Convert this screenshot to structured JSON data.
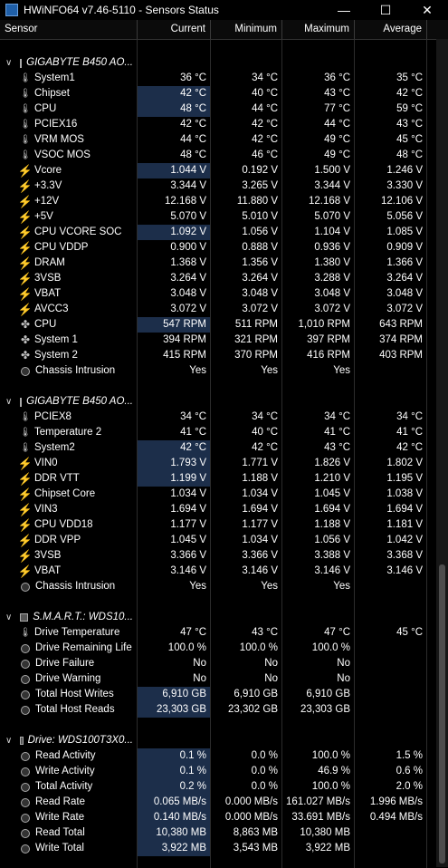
{
  "window": {
    "title": "HWiNFO64 v7.46-5110 - Sensors Status"
  },
  "columns": {
    "sensor": "Sensor",
    "current": "Current",
    "minimum": "Minimum",
    "maximum": "Maximum",
    "average": "Average"
  },
  "groups": [
    {
      "name": "GIGABYTE B450 AO...",
      "icon": "chip-icon",
      "rows": [
        {
          "n": "System1",
          "i": "thermo",
          "c": "36 °C",
          "mi": "34 °C",
          "ma": "36 °C",
          "a": "35 °C"
        },
        {
          "n": "Chipset",
          "i": "thermo",
          "c": "42 °C",
          "mi": "40 °C",
          "ma": "43 °C",
          "a": "42 °C",
          "hl": true
        },
        {
          "n": "CPU",
          "i": "thermo",
          "c": "48 °C",
          "mi": "44 °C",
          "ma": "77 °C",
          "a": "59 °C",
          "hl": true
        },
        {
          "n": "PCIEX16",
          "i": "thermo",
          "c": "42 °C",
          "mi": "42 °C",
          "ma": "44 °C",
          "a": "43 °C"
        },
        {
          "n": "VRM MOS",
          "i": "thermo",
          "c": "44 °C",
          "mi": "42 °C",
          "ma": "49 °C",
          "a": "45 °C"
        },
        {
          "n": "VSOC MOS",
          "i": "thermo",
          "c": "48 °C",
          "mi": "46 °C",
          "ma": "49 °C",
          "a": "48 °C"
        },
        {
          "n": "Vcore",
          "i": "bolt",
          "c": "1.044 V",
          "mi": "0.192 V",
          "ma": "1.500 V",
          "a": "1.246 V",
          "hl": true
        },
        {
          "n": "+3.3V",
          "i": "bolt",
          "c": "3.344 V",
          "mi": "3.265 V",
          "ma": "3.344 V",
          "a": "3.330 V"
        },
        {
          "n": "+12V",
          "i": "bolt",
          "c": "12.168 V",
          "mi": "11.880 V",
          "ma": "12.168 V",
          "a": "12.106 V"
        },
        {
          "n": "+5V",
          "i": "bolt",
          "c": "5.070 V",
          "mi": "5.010 V",
          "ma": "5.070 V",
          "a": "5.056 V"
        },
        {
          "n": "CPU VCORE SOC",
          "i": "bolt",
          "c": "1.092 V",
          "mi": "1.056 V",
          "ma": "1.104 V",
          "a": "1.085 V",
          "hl": true
        },
        {
          "n": "CPU VDDP",
          "i": "bolt",
          "c": "0.900 V",
          "mi": "0.888 V",
          "ma": "0.936 V",
          "a": "0.909 V"
        },
        {
          "n": "DRAM",
          "i": "bolt",
          "c": "1.368 V",
          "mi": "1.356 V",
          "ma": "1.380 V",
          "a": "1.366 V"
        },
        {
          "n": "3VSB",
          "i": "bolt",
          "c": "3.264 V",
          "mi": "3.264 V",
          "ma": "3.288 V",
          "a": "3.264 V"
        },
        {
          "n": "VBAT",
          "i": "bolt",
          "c": "3.048 V",
          "mi": "3.048 V",
          "ma": "3.048 V",
          "a": "3.048 V"
        },
        {
          "n": "AVCC3",
          "i": "bolt",
          "c": "3.072 V",
          "mi": "3.072 V",
          "ma": "3.072 V",
          "a": "3.072 V"
        },
        {
          "n": "CPU",
          "i": "fan",
          "c": "547 RPM",
          "mi": "511 RPM",
          "ma": "1,010 RPM",
          "a": "643 RPM",
          "hl": true
        },
        {
          "n": "System 1",
          "i": "fan",
          "c": "394 RPM",
          "mi": "321 RPM",
          "ma": "397 RPM",
          "a": "374 RPM"
        },
        {
          "n": "System 2",
          "i": "fan",
          "c": "415 RPM",
          "mi": "370 RPM",
          "ma": "416 RPM",
          "a": "403 RPM"
        },
        {
          "n": "Chassis Intrusion",
          "i": "circ",
          "c": "Yes",
          "mi": "Yes",
          "ma": "Yes",
          "a": ""
        }
      ]
    },
    {
      "name": "GIGABYTE B450 AO...",
      "icon": "chip-icon",
      "rows": [
        {
          "n": "PCIEX8",
          "i": "thermo",
          "c": "34 °C",
          "mi": "34 °C",
          "ma": "34 °C",
          "a": "34 °C"
        },
        {
          "n": "Temperature 2",
          "i": "thermo",
          "c": "41 °C",
          "mi": "40 °C",
          "ma": "41 °C",
          "a": "41 °C"
        },
        {
          "n": "System2",
          "i": "thermo",
          "c": "42 °C",
          "mi": "42 °C",
          "ma": "43 °C",
          "a": "42 °C",
          "hl": true
        },
        {
          "n": "VIN0",
          "i": "bolt",
          "c": "1.793 V",
          "mi": "1.771 V",
          "ma": "1.826 V",
          "a": "1.802 V",
          "hl": true
        },
        {
          "n": "DDR VTT",
          "i": "bolt",
          "c": "1.199 V",
          "mi": "1.188 V",
          "ma": "1.210 V",
          "a": "1.195 V",
          "hl": true
        },
        {
          "n": "Chipset Core",
          "i": "bolt",
          "c": "1.034 V",
          "mi": "1.034 V",
          "ma": "1.045 V",
          "a": "1.038 V"
        },
        {
          "n": "VIN3",
          "i": "bolt",
          "c": "1.694 V",
          "mi": "1.694 V",
          "ma": "1.694 V",
          "a": "1.694 V"
        },
        {
          "n": "CPU VDD18",
          "i": "bolt",
          "c": "1.177 V",
          "mi": "1.177 V",
          "ma": "1.188 V",
          "a": "1.181 V"
        },
        {
          "n": "DDR VPP",
          "i": "bolt",
          "c": "1.045 V",
          "mi": "1.034 V",
          "ma": "1.056 V",
          "a": "1.042 V"
        },
        {
          "n": "3VSB",
          "i": "bolt",
          "c": "3.366 V",
          "mi": "3.366 V",
          "ma": "3.388 V",
          "a": "3.368 V"
        },
        {
          "n": "VBAT",
          "i": "bolt",
          "c": "3.146 V",
          "mi": "3.146 V",
          "ma": "3.146 V",
          "a": "3.146 V"
        },
        {
          "n": "Chassis Intrusion",
          "i": "circ",
          "c": "Yes",
          "mi": "Yes",
          "ma": "Yes",
          "a": ""
        }
      ]
    },
    {
      "name": "S.M.A.R.T.: WDS10...",
      "icon": "drive-icon",
      "rows": [
        {
          "n": "Drive Temperature",
          "i": "thermo",
          "c": "47 °C",
          "mi": "43 °C",
          "ma": "47 °C",
          "a": "45 °C"
        },
        {
          "n": "Drive Remaining Life",
          "i": "circ",
          "c": "100.0 %",
          "mi": "100.0 %",
          "ma": "100.0 %",
          "a": ""
        },
        {
          "n": "Drive Failure",
          "i": "circ",
          "c": "No",
          "mi": "No",
          "ma": "No",
          "a": ""
        },
        {
          "n": "Drive Warning",
          "i": "circ",
          "c": "No",
          "mi": "No",
          "ma": "No",
          "a": ""
        },
        {
          "n": "Total Host Writes",
          "i": "circ",
          "c": "6,910 GB",
          "mi": "6,910 GB",
          "ma": "6,910 GB",
          "a": "",
          "hl": true
        },
        {
          "n": "Total Host Reads",
          "i": "circ",
          "c": "23,303 GB",
          "mi": "23,302 GB",
          "ma": "23,303 GB",
          "a": "",
          "hl": true
        }
      ]
    },
    {
      "name": "Drive: WDS100T3X0...",
      "icon": "drive-icon",
      "rows": [
        {
          "n": "Read Activity",
          "i": "circ",
          "c": "0.1 %",
          "mi": "0.0 %",
          "ma": "100.0 %",
          "a": "1.5 %",
          "hl": true
        },
        {
          "n": "Write Activity",
          "i": "circ",
          "c": "0.1 %",
          "mi": "0.0 %",
          "ma": "46.9 %",
          "a": "0.6 %",
          "hl": true
        },
        {
          "n": "Total Activity",
          "i": "circ",
          "c": "0.2 %",
          "mi": "0.0 %",
          "ma": "100.0 %",
          "a": "2.0 %",
          "hl": true
        },
        {
          "n": "Read Rate",
          "i": "circ",
          "c": "0.065 MB/s",
          "mi": "0.000 MB/s",
          "ma": "161.027 MB/s",
          "a": "1.996 MB/s",
          "hl": true
        },
        {
          "n": "Write Rate",
          "i": "circ",
          "c": "0.140 MB/s",
          "mi": "0.000 MB/s",
          "ma": "33.691 MB/s",
          "a": "0.494 MB/s",
          "hl": true
        },
        {
          "n": "Read Total",
          "i": "circ",
          "c": "10,380 MB",
          "mi": "8,863 MB",
          "ma": "10,380 MB",
          "a": "",
          "hl": true
        },
        {
          "n": "Write Total",
          "i": "circ",
          "c": "3,922 MB",
          "mi": "3,543 MB",
          "ma": "3,922 MB",
          "a": "",
          "hl": true
        }
      ]
    }
  ]
}
